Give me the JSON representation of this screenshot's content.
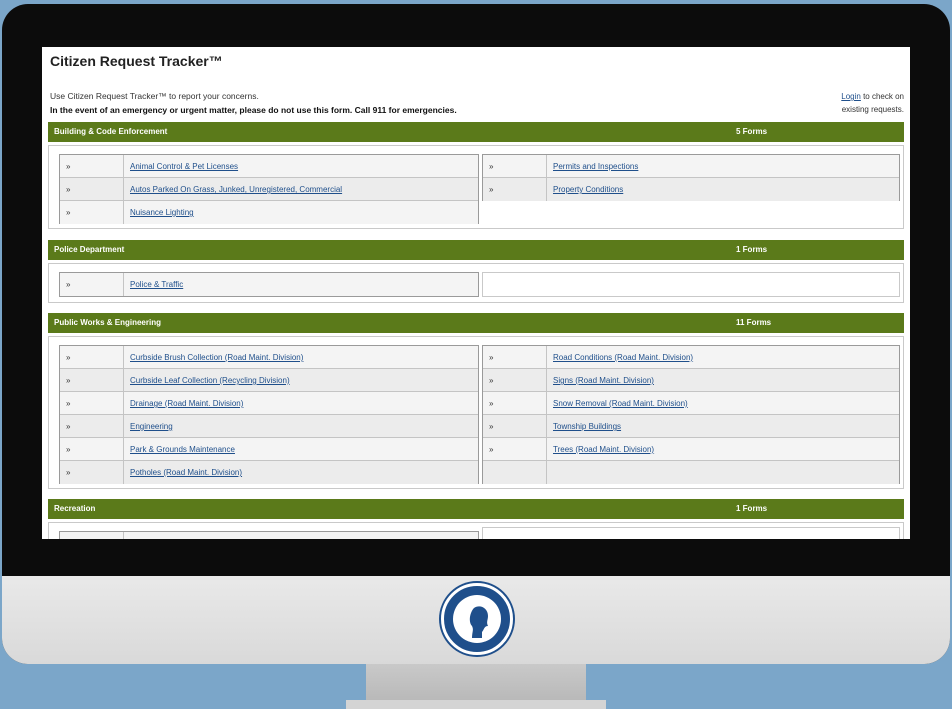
{
  "page": {
    "title": "Citizen Request Tracker™",
    "intro": "Use Citizen Request Tracker™ to report your concerns.",
    "warning": "In the event of an emergency or urgent matter, please do not use this form. Call 911 for emergencies.",
    "login_link": "Login",
    "login_text": " to check on existing requests."
  },
  "arrow_glyph": "»",
  "colors": {
    "category_bar": "#5b7a1a",
    "link": "#1f4f8b"
  },
  "categories": [
    {
      "name": "Building & Code Enforcement",
      "count": "5 Forms",
      "left": [
        "Animal Control & Pet Licenses",
        "Autos Parked On Grass, Junked, Unregistered, Commercial",
        "Nuisance Lighting"
      ],
      "right": [
        "Permits and Inspections",
        "Property Conditions"
      ]
    },
    {
      "name": "Police Department",
      "count": "1 Forms",
      "left": [
        "Police & Traffic"
      ],
      "right": []
    },
    {
      "name": "Public Works & Engineering",
      "count": "11 Forms",
      "left": [
        "Curbside Brush Collection (Road Maint. Division)",
        "Curbside Leaf Collection (Recycling Division)",
        "Drainage (Road Maint. Division)",
        "Engineering",
        "Park & Grounds Maintenance",
        "Potholes (Road Maint. Division)"
      ],
      "right": [
        "Road Conditions (Road Maint. Division)",
        "Signs (Road Maint. Division)",
        "Snow Removal (Road Maint. Division)",
        "Township Buildings",
        "Trees (Road Maint. Division)",
        ""
      ]
    },
    {
      "name": "Recreation",
      "count": "1 Forms",
      "left": [
        ""
      ],
      "right": []
    }
  ]
}
